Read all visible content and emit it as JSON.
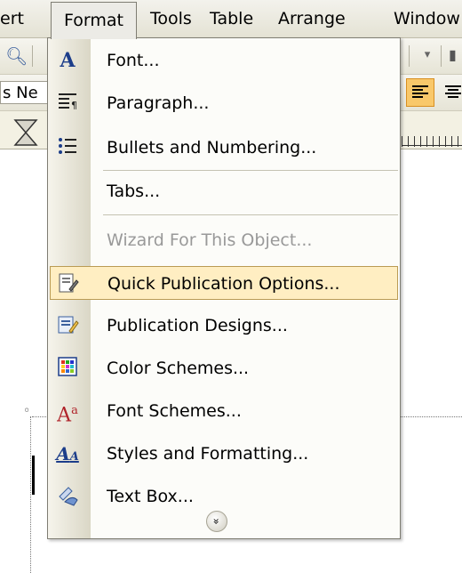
{
  "menubar": {
    "items": [
      {
        "label": "ert"
      },
      {
        "label": "Format"
      },
      {
        "label": "Tools"
      },
      {
        "label": "Table"
      },
      {
        "label": "Arrange"
      },
      {
        "label": "Window"
      }
    ]
  },
  "toolbar": {
    "font_name_value": "s Ne"
  },
  "format_menu": {
    "items": [
      {
        "label": "Font...",
        "icon": "font-icon"
      },
      {
        "label": "Paragraph...",
        "icon": "paragraph-icon"
      },
      {
        "label": "Bullets and Numbering...",
        "icon": "bullets-icon"
      },
      {
        "label": "Tabs...",
        "icon": ""
      },
      {
        "label": "Wizard For This Object...",
        "icon": "",
        "disabled": true
      },
      {
        "label": "Quick Publication Options...",
        "icon": "quick-publication-icon",
        "highlighted": true
      },
      {
        "label": "Publication Designs...",
        "icon": "publication-designs-icon"
      },
      {
        "label": "Color Schemes...",
        "icon": "color-schemes-icon"
      },
      {
        "label": "Font Schemes...",
        "icon": "font-schemes-icon"
      },
      {
        "label": "Styles and Formatting...",
        "icon": "styles-icon"
      },
      {
        "label": "Text Box...",
        "icon": "text-box-icon"
      }
    ],
    "expand_icon": "double-chevron-down-icon"
  },
  "colors": {
    "highlight_fill": "#ffeec2",
    "highlight_border": "#ba9b54",
    "align_active": "#f9c86a"
  }
}
